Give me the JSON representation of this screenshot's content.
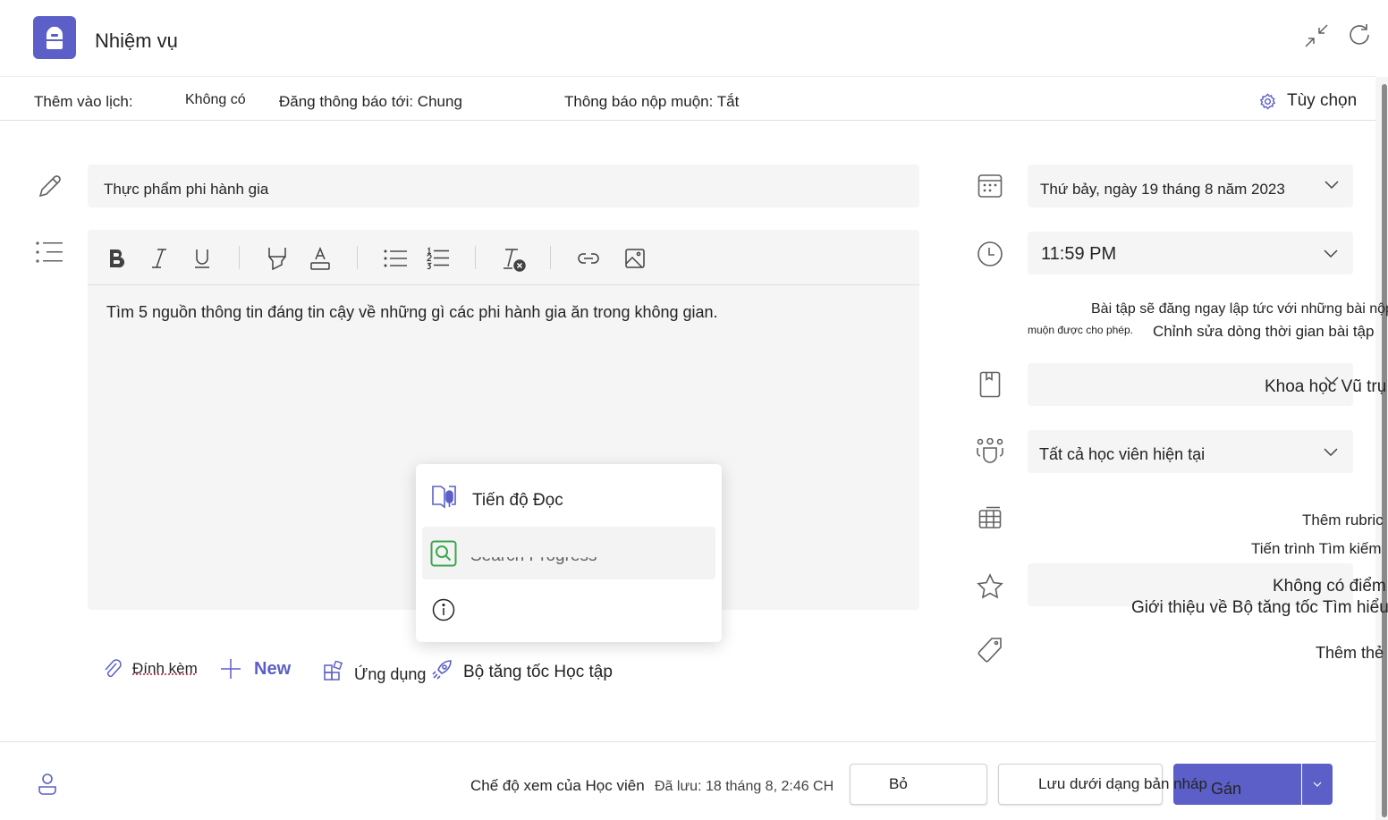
{
  "header": {
    "title": "Nhiệm vụ",
    "app_icon": "backpack-icon",
    "collapse_icon": "collapse-icon",
    "refresh_icon": "refresh-icon"
  },
  "options_bar": {
    "calendar_label": "Thêm vào lịch:",
    "calendar_value": "Không có",
    "post_to": "Đăng thông báo tới: Chung",
    "late_notice": "Thông báo nộp muộn: Tắt",
    "options_label": "Tùy chọn"
  },
  "form": {
    "title_value": "Thực phẩm phi hành gia",
    "instructions": "Tìm 5 nguồn thông tin đáng tin cậy về những gì các phi hành gia ăn trong không gian.",
    "toolbar": [
      "bold",
      "italic",
      "underline",
      "highlight",
      "font-color",
      "bulleted-list",
      "numbered-list",
      "clear-formatting",
      "link",
      "image"
    ],
    "attach_label": "Đính kèm",
    "new_label": "New",
    "apps_label": "Ứng dụng",
    "accelerator_label": "Bộ tăng tốc Học tập"
  },
  "popup": {
    "items": [
      {
        "label": "Tiến độ Đọc",
        "icon": "reading-progress-icon"
      },
      {
        "label": "Search Progress",
        "icon": "search-progress-icon"
      },
      {
        "label": "",
        "icon": "info-icon"
      }
    ]
  },
  "sidebar": {
    "due_date": "Thứ bảy, ngày 19 tháng 8 năm 2023",
    "due_time": "11:59 PM",
    "note_line1": "Bài tập sẽ đăng ngay lập tức với những bài nộp",
    "note_line2": "muộn được cho phép.",
    "edit_timeline": "Chỉnh sửa dòng thời gian bài tập",
    "class": "Khoa học Vũ trụ",
    "students": "Tất cả học viên hiện tại",
    "add_rubric": "Thêm rubric",
    "search_progress": "Tiến trình Tìm kiếm",
    "points": "Không có điểm",
    "intro": "Giới thiệu về Bộ tăng tốc Tìm hiểu",
    "add_tag": "Thêm thẻ"
  },
  "footer": {
    "student_view": "Chế độ xem của Học viên",
    "saved": "Đã lưu: 18 tháng 8, 2:46 CH",
    "discard": "Bỏ",
    "save_draft": "Lưu dưới dạng bản nháp",
    "assign": "Gán"
  },
  "colors": {
    "accent": "#5b5fc7",
    "field_bg": "#f5f5f5",
    "search_green": "#3ba64f"
  }
}
